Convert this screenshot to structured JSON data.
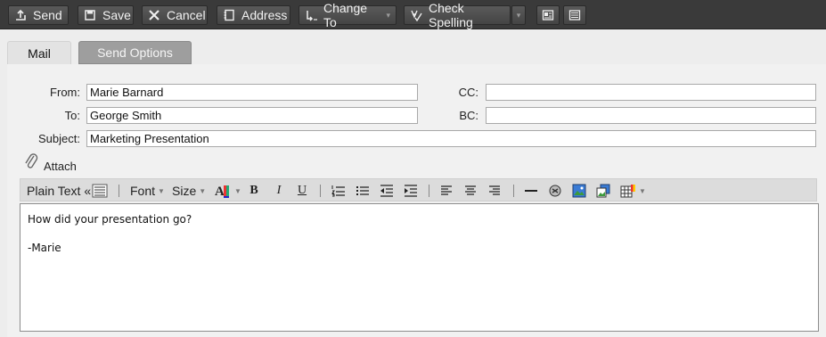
{
  "toolbar": {
    "send": "Send",
    "save": "Save",
    "cancel": "Cancel",
    "address": "Address",
    "change_to": "Change To",
    "check_spelling": "Check Spelling"
  },
  "tabs": {
    "mail": "Mail",
    "send_options": "Send Options"
  },
  "header": {
    "from_label": "From:",
    "from_value": "Marie Barnard",
    "to_label": "To:",
    "to_value": "George Smith",
    "subject_label": "Subject:",
    "subject_value": "Marketing Presentation",
    "cc_label": "CC:",
    "cc_value": "",
    "bc_label": "BC:",
    "bc_value": ""
  },
  "attach_label": "Attach",
  "format": {
    "plain_text": "Plain Text «",
    "font": "Font",
    "size": "Size",
    "bold": "B",
    "italic": "I",
    "underline": "U"
  },
  "body": {
    "line1": "How did your presentation go?",
    "line2": "-Marie"
  },
  "colors": {
    "toolbar_bg": "#3a3a3a",
    "panel_bg": "#ededed",
    "tab_inactive": "#9e9e9e"
  }
}
